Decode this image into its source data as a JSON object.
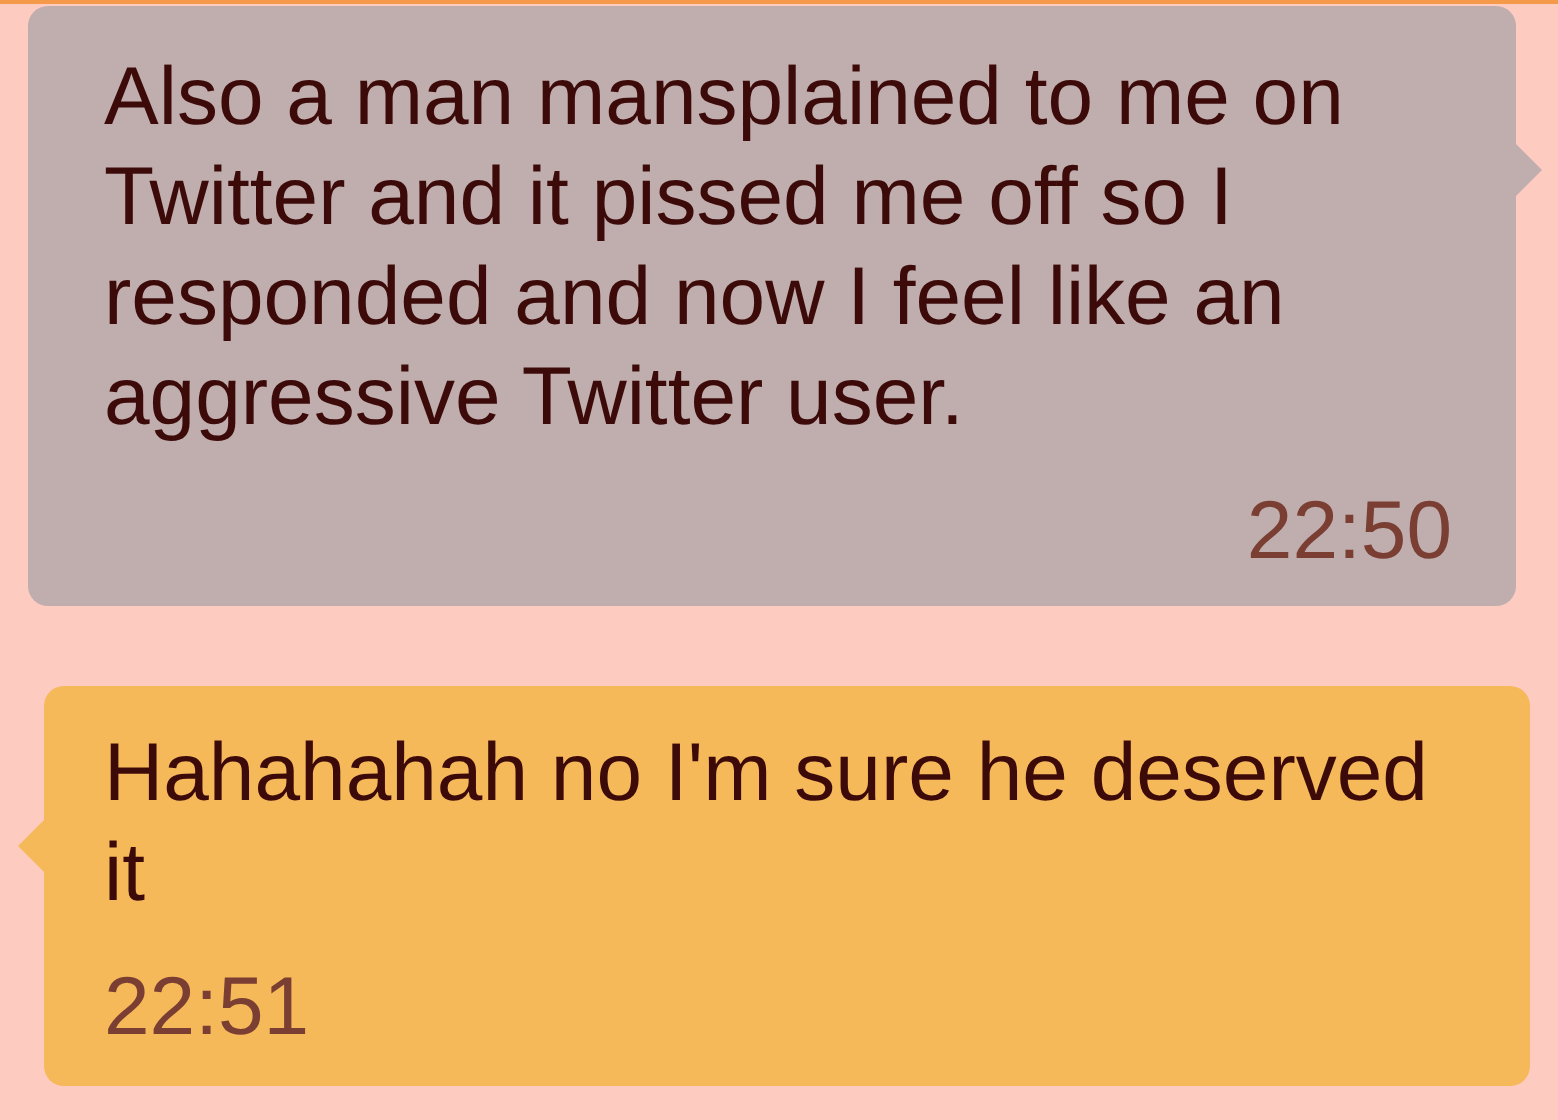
{
  "messages": [
    {
      "kind": "outgoing",
      "text": "Also a man mansplained to me on Twitter and it pissed me off so I responded and now I feel like an aggressive Twitter user.",
      "time": "22:50"
    },
    {
      "kind": "incoming",
      "text": "Hahahahah no I'm sure he deserved it",
      "time": "22:51"
    }
  ]
}
